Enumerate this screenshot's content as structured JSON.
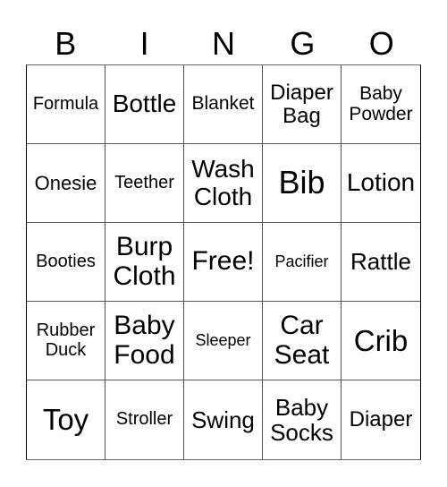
{
  "header": {
    "letters": [
      "B",
      "I",
      "N",
      "G",
      "O"
    ]
  },
  "grid": {
    "rows": [
      [
        "Formula",
        "Bottle",
        "Blanket",
        "Diaper Bag",
        "Baby Powder"
      ],
      [
        "Onesie",
        "Teether",
        "Wash Cloth",
        "Bib",
        "Lotion"
      ],
      [
        "Booties",
        "Burp Cloth",
        "Free!",
        "Pacifier",
        "Rattle"
      ],
      [
        "Rubber Duck",
        "Baby Food",
        "Sleeper",
        "Car Seat",
        "Crib"
      ],
      [
        "Toy",
        "Stroller",
        "Swing",
        "Baby Socks",
        "Diaper"
      ]
    ]
  }
}
